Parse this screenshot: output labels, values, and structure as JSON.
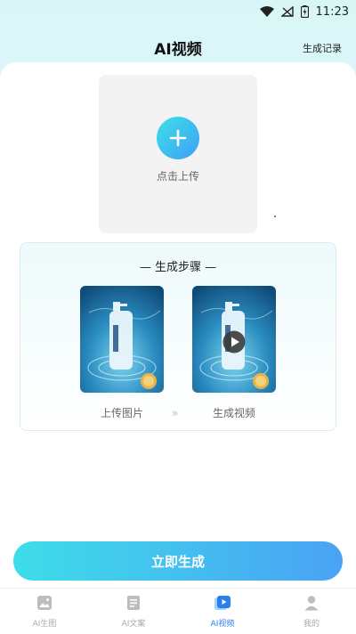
{
  "status_bar": {
    "time": "11:23",
    "icons": [
      "wifi-icon",
      "signal-off-icon",
      "battery-charging-icon"
    ]
  },
  "header": {
    "title": "AI视频",
    "action_label": "生成记录"
  },
  "upload": {
    "label": "点击上传",
    "icon": "plus-icon"
  },
  "steps": {
    "title": "— 生成步骤 —",
    "items": [
      {
        "label": "上传图片",
        "icon": "product-image"
      },
      {
        "label": "生成视频",
        "icon": "play-icon"
      }
    ],
    "separator": "»"
  },
  "cta": {
    "label": "立即生成"
  },
  "tabbar": {
    "items": [
      {
        "label": "AI生图",
        "icon": "image-icon",
        "active": false
      },
      {
        "label": "AI文案",
        "icon": "document-icon",
        "active": false
      },
      {
        "label": "AI视频",
        "icon": "video-icon",
        "active": true
      },
      {
        "label": "我的",
        "icon": "user-icon",
        "active": false
      }
    ]
  },
  "colors": {
    "accent": "#2a7ff0",
    "gradient_start": "#3ddde9",
    "gradient_end": "#4aa2f5",
    "background_top": "#d9f6f7"
  }
}
